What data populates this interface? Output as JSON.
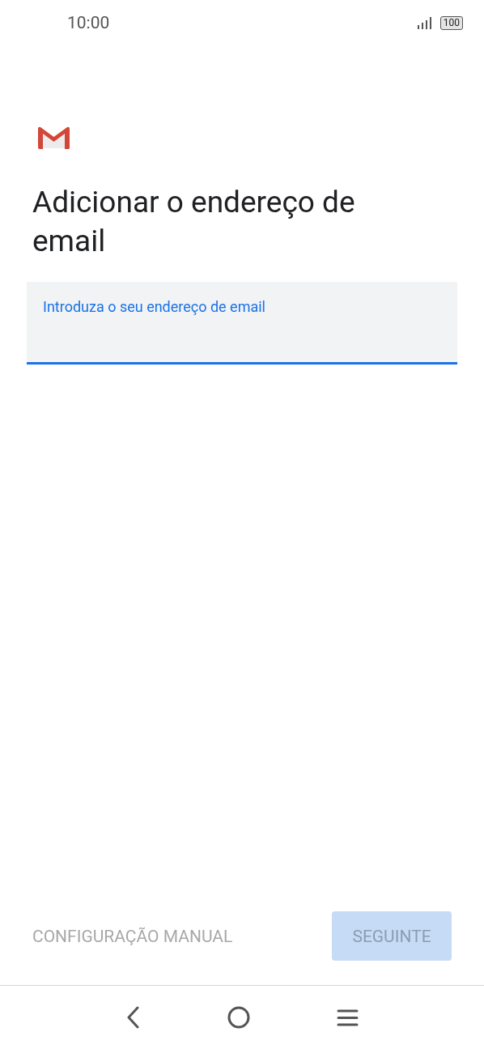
{
  "status_bar": {
    "time": "10:00",
    "battery": "100"
  },
  "title": "Adicionar o endereço de email",
  "email_field": {
    "placeholder": "Introduza o seu endereço de email",
    "focused": true
  },
  "buttons": [
    {
      "kind": "text",
      "label": "CONFIGURAÇÃO MANUAL",
      "disabled": true
    },
    {
      "kind": "filled",
      "label": "SEGUINTE",
      "disabled": true
    }
  ]
}
